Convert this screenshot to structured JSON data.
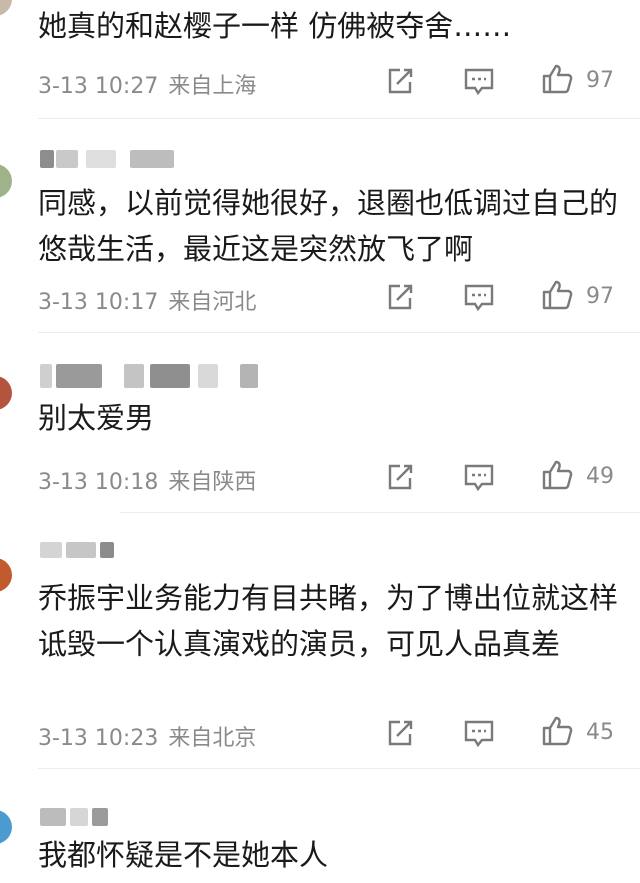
{
  "comments": [
    {
      "text": "她真的和赵樱子一样 仿佛被夺舍……",
      "time": "3-13 10:27",
      "location": "来自上海",
      "likes": "97"
    },
    {
      "text": "同感，以前觉得她很好，退圈也低调过自己的悠哉生活，最近这是突然放飞了啊",
      "time": "3-13 10:17",
      "location": "来自河北",
      "likes": "97"
    },
    {
      "text": "别太爱男",
      "time": "3-13 10:18",
      "location": "来自陕西",
      "likes": "49"
    },
    {
      "text": "乔振宇业务能力有目共睹，为了博出位就这样诋毁一个认真演戏的演员，可见人品真差",
      "time": "3-13 10:23",
      "location": "来自北京",
      "likes": "45"
    },
    {
      "text": "我都怀疑是不是她本人",
      "time": "",
      "location": "",
      "likes": ""
    }
  ],
  "icons": {
    "share": "share-icon",
    "comment": "comment-icon",
    "like": "thumbs-up-icon"
  },
  "colors": {
    "text": "#1a1a1a",
    "meta": "#8a8a8a",
    "icon": "#7a7a7a"
  }
}
